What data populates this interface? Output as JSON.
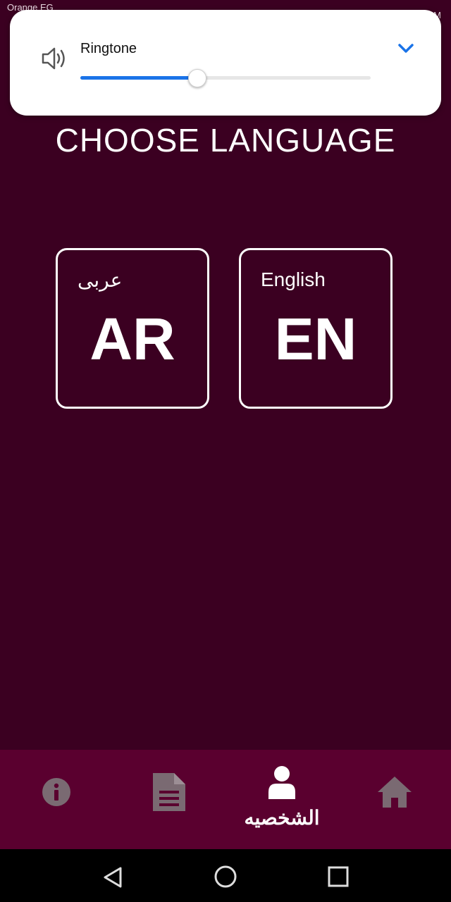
{
  "status_bar": {
    "carrier": "Orange EG",
    "time": "M"
  },
  "volume_panel": {
    "label": "Ringtone",
    "level": 0.4
  },
  "page_title": "CHOOSE LANGUAGE",
  "languages": [
    {
      "small_label": "عربى",
      "code": "AR"
    },
    {
      "small_label": "English",
      "code": "EN"
    }
  ],
  "bottom_nav": {
    "items": [
      {
        "icon": "info-icon"
      },
      {
        "icon": "document-icon"
      },
      {
        "icon": "profile-icon",
        "label": "الشخصيه"
      },
      {
        "icon": "home-icon"
      }
    ]
  },
  "colors": {
    "background": "#3b0021",
    "nav_background": "#5a002f",
    "slider_accent": "#1a73e8",
    "inactive_icon": "#7a6a72"
  }
}
